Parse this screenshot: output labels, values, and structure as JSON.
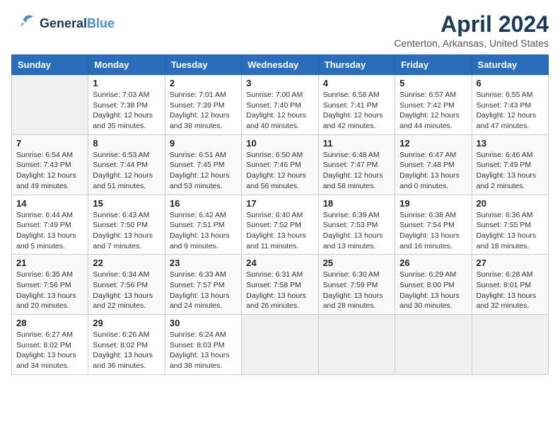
{
  "header": {
    "logo_general": "General",
    "logo_blue": "Blue",
    "month": "April 2024",
    "location": "Centerton, Arkansas, United States"
  },
  "weekdays": [
    "Sunday",
    "Monday",
    "Tuesday",
    "Wednesday",
    "Thursday",
    "Friday",
    "Saturday"
  ],
  "weeks": [
    [
      {
        "day": "",
        "info": ""
      },
      {
        "day": "1",
        "info": "Sunrise: 7:03 AM\nSunset: 7:38 PM\nDaylight: 12 hours\nand 35 minutes."
      },
      {
        "day": "2",
        "info": "Sunrise: 7:01 AM\nSunset: 7:39 PM\nDaylight: 12 hours\nand 38 minutes."
      },
      {
        "day": "3",
        "info": "Sunrise: 7:00 AM\nSunset: 7:40 PM\nDaylight: 12 hours\nand 40 minutes."
      },
      {
        "day": "4",
        "info": "Sunrise: 6:58 AM\nSunset: 7:41 PM\nDaylight: 12 hours\nand 42 minutes."
      },
      {
        "day": "5",
        "info": "Sunrise: 6:57 AM\nSunset: 7:42 PM\nDaylight: 12 hours\nand 44 minutes."
      },
      {
        "day": "6",
        "info": "Sunrise: 6:55 AM\nSunset: 7:43 PM\nDaylight: 12 hours\nand 47 minutes."
      }
    ],
    [
      {
        "day": "7",
        "info": "Sunrise: 6:54 AM\nSunset: 7:43 PM\nDaylight: 12 hours\nand 49 minutes."
      },
      {
        "day": "8",
        "info": "Sunrise: 6:53 AM\nSunset: 7:44 PM\nDaylight: 12 hours\nand 51 minutes."
      },
      {
        "day": "9",
        "info": "Sunrise: 6:51 AM\nSunset: 7:45 PM\nDaylight: 12 hours\nand 53 minutes."
      },
      {
        "day": "10",
        "info": "Sunrise: 6:50 AM\nSunset: 7:46 PM\nDaylight: 12 hours\nand 56 minutes."
      },
      {
        "day": "11",
        "info": "Sunrise: 6:48 AM\nSunset: 7:47 PM\nDaylight: 12 hours\nand 58 minutes."
      },
      {
        "day": "12",
        "info": "Sunrise: 6:47 AM\nSunset: 7:48 PM\nDaylight: 13 hours\nand 0 minutes."
      },
      {
        "day": "13",
        "info": "Sunrise: 6:46 AM\nSunset: 7:49 PM\nDaylight: 13 hours\nand 2 minutes."
      }
    ],
    [
      {
        "day": "14",
        "info": "Sunrise: 6:44 AM\nSunset: 7:49 PM\nDaylight: 13 hours\nand 5 minutes."
      },
      {
        "day": "15",
        "info": "Sunrise: 6:43 AM\nSunset: 7:50 PM\nDaylight: 13 hours\nand 7 minutes."
      },
      {
        "day": "16",
        "info": "Sunrise: 6:42 AM\nSunset: 7:51 PM\nDaylight: 13 hours\nand 9 minutes."
      },
      {
        "day": "17",
        "info": "Sunrise: 6:40 AM\nSunset: 7:52 PM\nDaylight: 13 hours\nand 11 minutes."
      },
      {
        "day": "18",
        "info": "Sunrise: 6:39 AM\nSunset: 7:53 PM\nDaylight: 13 hours\nand 13 minutes."
      },
      {
        "day": "19",
        "info": "Sunrise: 6:38 AM\nSunset: 7:54 PM\nDaylight: 13 hours\nand 16 minutes."
      },
      {
        "day": "20",
        "info": "Sunrise: 6:36 AM\nSunset: 7:55 PM\nDaylight: 13 hours\nand 18 minutes."
      }
    ],
    [
      {
        "day": "21",
        "info": "Sunrise: 6:35 AM\nSunset: 7:56 PM\nDaylight: 13 hours\nand 20 minutes."
      },
      {
        "day": "22",
        "info": "Sunrise: 6:34 AM\nSunset: 7:56 PM\nDaylight: 13 hours\nand 22 minutes."
      },
      {
        "day": "23",
        "info": "Sunrise: 6:33 AM\nSunset: 7:57 PM\nDaylight: 13 hours\nand 24 minutes."
      },
      {
        "day": "24",
        "info": "Sunrise: 6:31 AM\nSunset: 7:58 PM\nDaylight: 13 hours\nand 26 minutes."
      },
      {
        "day": "25",
        "info": "Sunrise: 6:30 AM\nSunset: 7:59 PM\nDaylight: 13 hours\nand 28 minutes."
      },
      {
        "day": "26",
        "info": "Sunrise: 6:29 AM\nSunset: 8:00 PM\nDaylight: 13 hours\nand 30 minutes."
      },
      {
        "day": "27",
        "info": "Sunrise: 6:28 AM\nSunset: 8:01 PM\nDaylight: 13 hours\nand 32 minutes."
      }
    ],
    [
      {
        "day": "28",
        "info": "Sunrise: 6:27 AM\nSunset: 8:02 PM\nDaylight: 13 hours\nand 34 minutes."
      },
      {
        "day": "29",
        "info": "Sunrise: 6:26 AM\nSunset: 8:02 PM\nDaylight: 13 hours\nand 36 minutes."
      },
      {
        "day": "30",
        "info": "Sunrise: 6:24 AM\nSunset: 8:03 PM\nDaylight: 13 hours\nand 38 minutes."
      },
      {
        "day": "",
        "info": ""
      },
      {
        "day": "",
        "info": ""
      },
      {
        "day": "",
        "info": ""
      },
      {
        "day": "",
        "info": ""
      }
    ]
  ]
}
